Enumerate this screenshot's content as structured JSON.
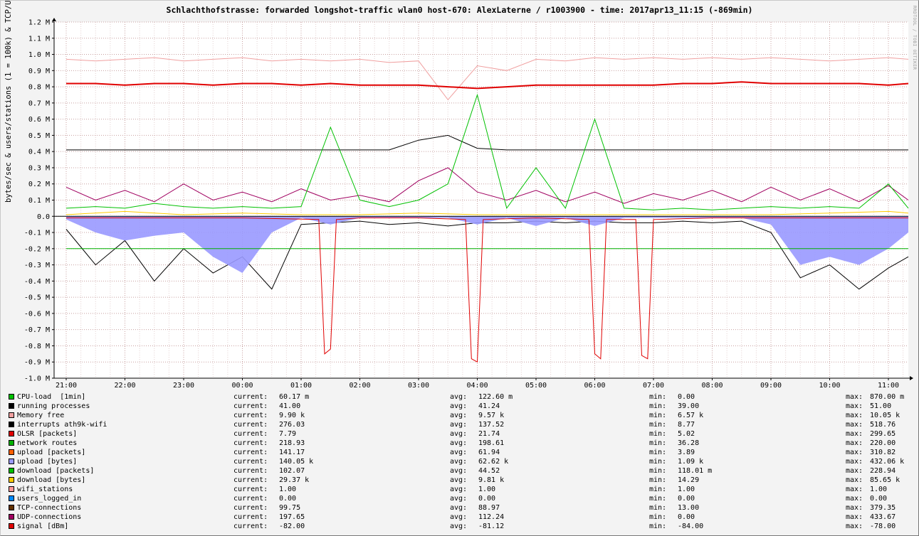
{
  "title": "Schlachthofstrasse: forwarded longshot-traffic wlan0 host-670: AlexLaterne / r1003900 - time: 2017apr13_11:15 (-869min)",
  "watermark": "RRDTOOL / TOBI OETIKER",
  "colors": {
    "background": "#f3f3f3",
    "plot": "#ffffff",
    "grid": "#c8a0a0"
  },
  "legend": {
    "current_label": "current:",
    "avg_label": "avg:",
    "min_label": "min:",
    "max_label": "max:",
    "items": [
      {
        "name": "CPU-load  [1min]",
        "color": "#00c000",
        "current": "60.17 m",
        "avg": "122.60 m",
        "min": "0.00",
        "max": "870.00 m"
      },
      {
        "name": "running processes",
        "color": "#000000",
        "current": "41.00",
        "avg": "41.24",
        "min": "39.00",
        "max": "51.00"
      },
      {
        "name": "Memory free",
        "color": "#f0a0a0",
        "current": "9.90 k",
        "avg": "9.57 k",
        "min": "6.57 k",
        "max": "10.05 k"
      },
      {
        "name": "interrupts ath9k-wifi",
        "color": "#000000",
        "current": "276.03",
        "avg": "137.52",
        "min": "8.77",
        "max": "518.76"
      },
      {
        "name": "OLSR [packets]",
        "color": "#e00000",
        "current": "7.79",
        "avg": "21.74",
        "min": "5.02",
        "max": "299.65"
      },
      {
        "name": "network routes",
        "color": "#00b000",
        "current": "218.93",
        "avg": "198.61",
        "min": "36.28",
        "max": "220.00"
      },
      {
        "name": "upload [packets]",
        "color": "#ff6000",
        "current": "141.17",
        "avg": "61.94",
        "min": "3.89",
        "max": "310.82"
      },
      {
        "name": "upload [bytes]",
        "color": "#9999ff",
        "current": "140.05 k",
        "avg": "62.62 k",
        "min": "1.09 k",
        "max": "432.06 k"
      },
      {
        "name": "download [packets]",
        "color": "#00c000",
        "current": "102.07",
        "avg": "44.52",
        "min": "118.01 m",
        "max": "228.94"
      },
      {
        "name": "download [bytes]",
        "color": "#ffcc00",
        "current": "29.37 k",
        "avg": "9.81 k",
        "min": "14.29",
        "max": "85.65 k"
      },
      {
        "name": "wifi_stations",
        "color": "#ff9999",
        "current": "1.00",
        "avg": "1.00",
        "min": "1.00",
        "max": "1.00"
      },
      {
        "name": "users_logged_in",
        "color": "#0088ff",
        "current": "0.00",
        "avg": "0.00",
        "min": "0.00",
        "max": "0.00"
      },
      {
        "name": "TCP-connections",
        "color": "#603000",
        "current": "99.75",
        "avg": "88.97",
        "min": "13.00",
        "max": "379.35"
      },
      {
        "name": "UDP-connections",
        "color": "#a00060",
        "current": "197.65",
        "avg": "112.24",
        "min": "0.00",
        "max": "433.67"
      },
      {
        "name": "signal [dBm]",
        "color": "#e00000",
        "current": "-82.00",
        "avg": "-81.12",
        "min": "-84.00",
        "max": "-78.00"
      }
    ]
  },
  "chart_data": {
    "type": "line",
    "title": "Schlachthofstrasse: forwarded longshot-traffic wlan0 host-670: AlexLaterne / r1003900 - time: 2017apr13_11:15 (-869min)",
    "ylabel": "bytes/sec & users/stations (1 = 100k) & TCP/UDP-conntrack (1000 = 1M)",
    "xlabel": "",
    "ylim": [
      -1.0,
      1.2
    ],
    "y_unit": "M",
    "yticks": [
      "1.2 M",
      "1.1 M",
      "1.0 M",
      "0.9 M",
      "0.8 M",
      "0.7 M",
      "0.6 M",
      "0.5 M",
      "0.4 M",
      "0.3 M",
      "0.2 M",
      "0.1 M",
      "0.0",
      "-0.1 M",
      "-0.2 M",
      "-0.3 M",
      "-0.4 M",
      "-0.5 M",
      "-0.6 M",
      "-0.7 M",
      "-0.8 M",
      "-0.9 M",
      "-1.0 M"
    ],
    "xlim": [
      20.75,
      11.25
    ],
    "xticks": [
      "21:00",
      "22:00",
      "23:00",
      "00:00",
      "01:00",
      "02:00",
      "03:00",
      "04:00",
      "05:00",
      "06:00",
      "07:00",
      "08:00",
      "09:00",
      "10:00",
      "11:00"
    ],
    "grid": true,
    "series": [
      {
        "name": "Memory free",
        "color": "#f0a0a0",
        "x": [
          0,
          0.5,
          1,
          1.5,
          2,
          2.5,
          3,
          3.5,
          4,
          4.5,
          5,
          5.5,
          6,
          6.5,
          7,
          7.5,
          8,
          8.5,
          9,
          9.5,
          10,
          10.5,
          11,
          11.5,
          12,
          12.5,
          13,
          13.5,
          14,
          14.5
        ],
        "y": [
          0.97,
          0.96,
          0.97,
          0.98,
          0.96,
          0.97,
          0.98,
          0.96,
          0.97,
          0.96,
          0.97,
          0.95,
          0.96,
          0.72,
          0.93,
          0.9,
          0.97,
          0.96,
          0.98,
          0.97,
          0.98,
          0.97,
          0.98,
          0.97,
          0.98,
          0.97,
          0.96,
          0.97,
          0.98,
          0.97
        ]
      },
      {
        "name": "signal [dBm]",
        "color": "#e00000",
        "x": [
          0,
          0.5,
          1,
          1.5,
          2,
          2.5,
          3,
          3.5,
          4,
          4.5,
          5,
          5.5,
          6,
          6.5,
          7,
          7.5,
          8,
          8.5,
          9,
          9.5,
          10,
          10.5,
          11,
          11.5,
          12,
          12.5,
          13,
          13.5,
          14,
          14.5
        ],
        "y": [
          0.82,
          0.82,
          0.81,
          0.82,
          0.82,
          0.81,
          0.82,
          0.82,
          0.81,
          0.82,
          0.81,
          0.81,
          0.81,
          0.8,
          0.79,
          0.8,
          0.81,
          0.81,
          0.81,
          0.81,
          0.81,
          0.82,
          0.82,
          0.83,
          0.82,
          0.82,
          0.82,
          0.82,
          0.81,
          0.82
        ]
      },
      {
        "name": "running processes",
        "color": "#000000",
        "x": [
          0,
          0.5,
          1,
          1.5,
          2,
          2.5,
          3,
          3.5,
          4,
          4.5,
          5,
          5.5,
          6,
          6.5,
          7,
          7.5,
          8,
          8.5,
          9,
          9.5,
          10,
          10.5,
          11,
          11.5,
          12,
          12.5,
          13,
          13.5,
          14,
          14.5
        ],
        "y": [
          0.41,
          0.41,
          0.41,
          0.41,
          0.41,
          0.41,
          0.41,
          0.41,
          0.41,
          0.41,
          0.41,
          0.41,
          0.47,
          0.5,
          0.42,
          0.41,
          0.41,
          0.41,
          0.41,
          0.41,
          0.41,
          0.41,
          0.41,
          0.41,
          0.41,
          0.41,
          0.41,
          0.41,
          0.41,
          0.41
        ]
      },
      {
        "name": "UDP-connections",
        "color": "#a00060",
        "x": [
          0,
          0.5,
          1,
          1.5,
          2,
          2.5,
          3,
          3.5,
          4,
          4.5,
          5,
          5.5,
          6,
          6.5,
          7,
          7.5,
          8,
          8.5,
          9,
          9.5,
          10,
          10.5,
          11,
          11.5,
          12,
          12.5,
          13,
          13.5,
          14,
          14.5
        ],
        "y": [
          0.18,
          0.1,
          0.16,
          0.09,
          0.2,
          0.1,
          0.15,
          0.09,
          0.17,
          0.1,
          0.13,
          0.09,
          0.22,
          0.3,
          0.15,
          0.1,
          0.16,
          0.09,
          0.15,
          0.08,
          0.14,
          0.1,
          0.16,
          0.09,
          0.18,
          0.1,
          0.17,
          0.09,
          0.19,
          0.1
        ]
      },
      {
        "name": "CPU-load  [1min]",
        "color": "#00c000",
        "x": [
          0,
          0.5,
          1,
          1.5,
          2,
          2.5,
          3,
          3.5,
          4,
          4.5,
          5,
          5.5,
          6,
          6.5,
          7,
          7.5,
          8,
          8.5,
          9,
          9.5,
          10,
          10.5,
          11,
          11.5,
          12,
          12.5,
          13,
          13.5,
          14,
          14.5
        ],
        "y": [
          0.05,
          0.06,
          0.05,
          0.08,
          0.06,
          0.05,
          0.06,
          0.05,
          0.06,
          0.55,
          0.1,
          0.06,
          0.1,
          0.2,
          0.75,
          0.05,
          0.3,
          0.05,
          0.6,
          0.05,
          0.04,
          0.05,
          0.04,
          0.05,
          0.06,
          0.05,
          0.06,
          0.05,
          0.2,
          0.05
        ]
      },
      {
        "name": "interrupts ath9k-wifi",
        "color": "#000000",
        "x": [
          0,
          0.5,
          1,
          1.5,
          2,
          2.5,
          3,
          3.5,
          4,
          4.5,
          5,
          5.5,
          6,
          6.5,
          7,
          7.5,
          8,
          8.5,
          9,
          9.5,
          10,
          10.5,
          11,
          11.5,
          12,
          12.5,
          13,
          13.5,
          14,
          14.5
        ],
        "y": [
          -0.08,
          -0.3,
          -0.15,
          -0.4,
          -0.2,
          -0.35,
          -0.25,
          -0.45,
          -0.05,
          -0.04,
          -0.03,
          -0.05,
          -0.04,
          -0.06,
          -0.04,
          -0.04,
          -0.03,
          -0.04,
          -0.03,
          -0.04,
          -0.04,
          -0.03,
          -0.04,
          -0.03,
          -0.1,
          -0.38,
          -0.3,
          -0.45,
          -0.32,
          -0.25
        ]
      },
      {
        "name": "upload [bytes]",
        "color": "#9999ff",
        "x": [
          0,
          0.5,
          1,
          1.5,
          2,
          2.5,
          3,
          3.5,
          4,
          4.5,
          5,
          5.5,
          6,
          6.5,
          7,
          7.5,
          8,
          8.5,
          9,
          9.5,
          10,
          10.5,
          11,
          11.5,
          12,
          12.5,
          13,
          13.5,
          14,
          14.5
        ],
        "y": [
          -0.02,
          -0.1,
          -0.15,
          -0.12,
          -0.1,
          -0.25,
          -0.35,
          -0.1,
          -0.01,
          -0.05,
          -0.01,
          -0.01,
          -0.01,
          -0.01,
          -0.05,
          -0.01,
          -0.06,
          -0.01,
          -0.06,
          -0.01,
          -0.01,
          -0.01,
          -0.01,
          -0.01,
          -0.05,
          -0.3,
          -0.25,
          -0.3,
          -0.2,
          -0.1
        ]
      },
      {
        "name": "network routes",
        "color": "#00b000",
        "x": [
          0,
          1,
          2,
          3,
          4,
          5,
          6,
          7,
          8,
          9,
          10,
          11,
          12,
          13,
          14,
          14.5
        ],
        "y": [
          -0.2,
          -0.2,
          -0.2,
          -0.2,
          -0.2,
          -0.2,
          -0.2,
          -0.2,
          -0.2,
          -0.2,
          -0.2,
          -0.2,
          -0.2,
          -0.2,
          -0.2,
          -0.2
        ]
      },
      {
        "name": "OLSR [packets]",
        "color": "#e00000",
        "x": [
          0,
          1,
          2,
          3,
          4.3,
          4.4,
          4.5,
          4.6,
          5,
          6,
          6.8,
          6.9,
          7.0,
          7.1,
          8,
          8.9,
          9.0,
          9.1,
          9.2,
          9.7,
          9.8,
          9.9,
          10.0,
          11,
          12,
          13,
          14,
          14.5
        ],
        "y": [
          -0.01,
          -0.01,
          -0.01,
          -0.01,
          -0.02,
          -0.85,
          -0.82,
          -0.02,
          -0.01,
          -0.01,
          -0.02,
          -0.88,
          -0.9,
          -0.02,
          -0.01,
          -0.02,
          -0.85,
          -0.88,
          -0.02,
          -0.02,
          -0.86,
          -0.88,
          -0.02,
          -0.01,
          -0.01,
          -0.01,
          -0.01,
          -0.01
        ]
      },
      {
        "name": "download [bytes]",
        "color": "#ffcc00",
        "x": [
          0,
          1,
          2,
          3,
          4,
          5,
          6,
          7,
          8,
          9,
          10,
          11,
          12,
          13,
          14,
          14.5
        ],
        "y": [
          0.01,
          0.03,
          0.01,
          0.02,
          0.01,
          0.01,
          0.02,
          0.01,
          0.01,
          0.01,
          0.01,
          0.01,
          0.01,
          0.02,
          0.03,
          0.02
        ]
      }
    ]
  }
}
